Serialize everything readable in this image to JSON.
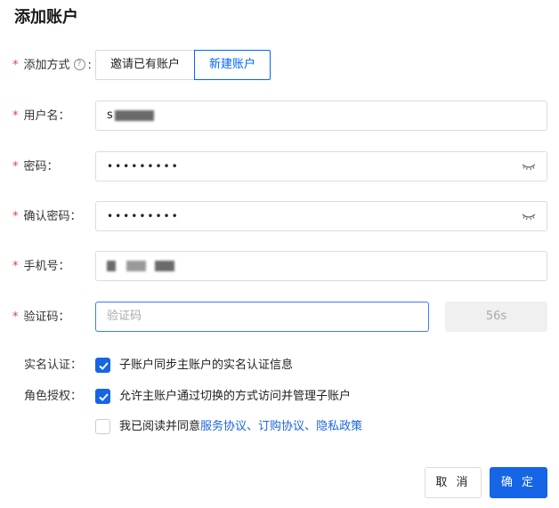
{
  "dialog": {
    "title": "添加账户"
  },
  "form": {
    "add_method": {
      "label": "添加方式",
      "suffix": ":",
      "options": [
        "邀请已有账户",
        "新建账户"
      ],
      "selected": "新建账户"
    },
    "username": {
      "label": "用户名：",
      "value_prefix": "s"
    },
    "password": {
      "label": "密码：",
      "value": "•••••••••"
    },
    "confirm_password": {
      "label": "确认密码：",
      "value": "•••••••••"
    },
    "phone": {
      "label": "手机号："
    },
    "code": {
      "label": "验证码：",
      "placeholder": "验证码",
      "countdown": "56s"
    },
    "real_name": {
      "label": "实名认证：",
      "text": "子账户同步主账户的实名认证信息",
      "checked": true
    },
    "role": {
      "label": "角色授权：",
      "text": "允许主账户通过切换的方式访问并管理子账户",
      "checked": true
    },
    "agreement": {
      "prefix": "我已阅读并同意",
      "links": [
        "服务协议",
        "订购协议",
        "隐私政策"
      ],
      "separator": "、",
      "checked": false
    }
  },
  "footer": {
    "cancel": "取 消",
    "ok": "确 定"
  },
  "colors": {
    "primary": "#1565e6",
    "required": "#e0443a",
    "link": "#1a66e0"
  }
}
